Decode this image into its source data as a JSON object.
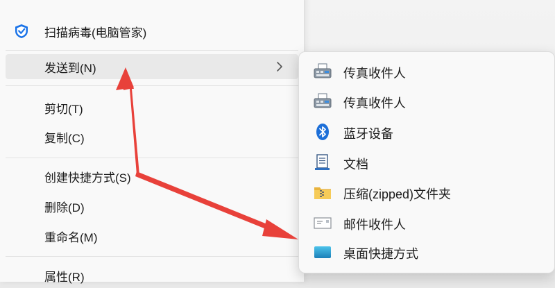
{
  "colors": {
    "menu_bg": "#f9f9f9",
    "hover_bg": "#e9e9e9",
    "arrow": "#e8413a",
    "scan_icon": "#1a73e8",
    "bluetooth": "#1d6fd8",
    "desktop_shortcut": "#2aa5d6"
  },
  "main_menu": {
    "items": [
      {
        "label": "扫描病毒(电脑管家)",
        "icon": "shield-icon"
      },
      {
        "label": "发送到(N)",
        "has_submenu": true,
        "hovered": true
      },
      {
        "label": "剪切(T)"
      },
      {
        "label": "复制(C)"
      },
      {
        "label": "创建快捷方式(S)"
      },
      {
        "label": "删除(D)"
      },
      {
        "label": "重命名(M)"
      },
      {
        "label": "属性(R)"
      }
    ]
  },
  "send_to_menu": {
    "items": [
      {
        "label": "传真收件人",
        "icon": "fax-icon"
      },
      {
        "label": "传真收件人",
        "icon": "fax-icon"
      },
      {
        "label": "蓝牙设备",
        "icon": "bluetooth-icon"
      },
      {
        "label": "文档",
        "icon": "document-icon"
      },
      {
        "label": "压缩(zipped)文件夹",
        "icon": "zip-folder-icon"
      },
      {
        "label": "邮件收件人",
        "icon": "mail-icon"
      },
      {
        "label": "桌面快捷方式",
        "icon": "desktop-shortcut-icon"
      }
    ]
  }
}
